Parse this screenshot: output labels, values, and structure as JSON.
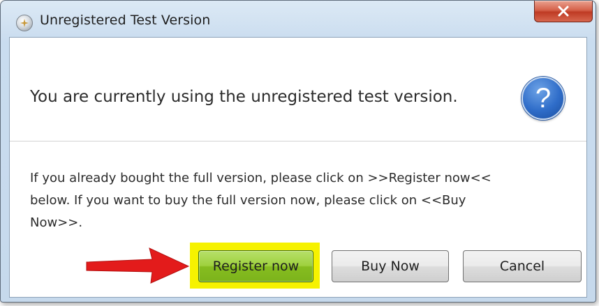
{
  "window": {
    "title": "Unregistered Test Version",
    "icon": "app-icon",
    "close_icon": "close-icon"
  },
  "message": {
    "main": "You are currently using the unregistered test version.",
    "icon": "question-icon",
    "icon_glyph": "?",
    "body_lines": [
      "If you already bought the full version, please click on >>Register now<<",
      "below. If you want to buy the full version now, please click on <<Buy",
      "Now>>."
    ]
  },
  "buttons": {
    "register": "Register now",
    "buy": "Buy Now",
    "cancel": "Cancel"
  },
  "annotation": {
    "arrow_icon": "red-arrow-icon",
    "arrow_color": "#e31b1b",
    "highlight_color": "#f6f200"
  }
}
